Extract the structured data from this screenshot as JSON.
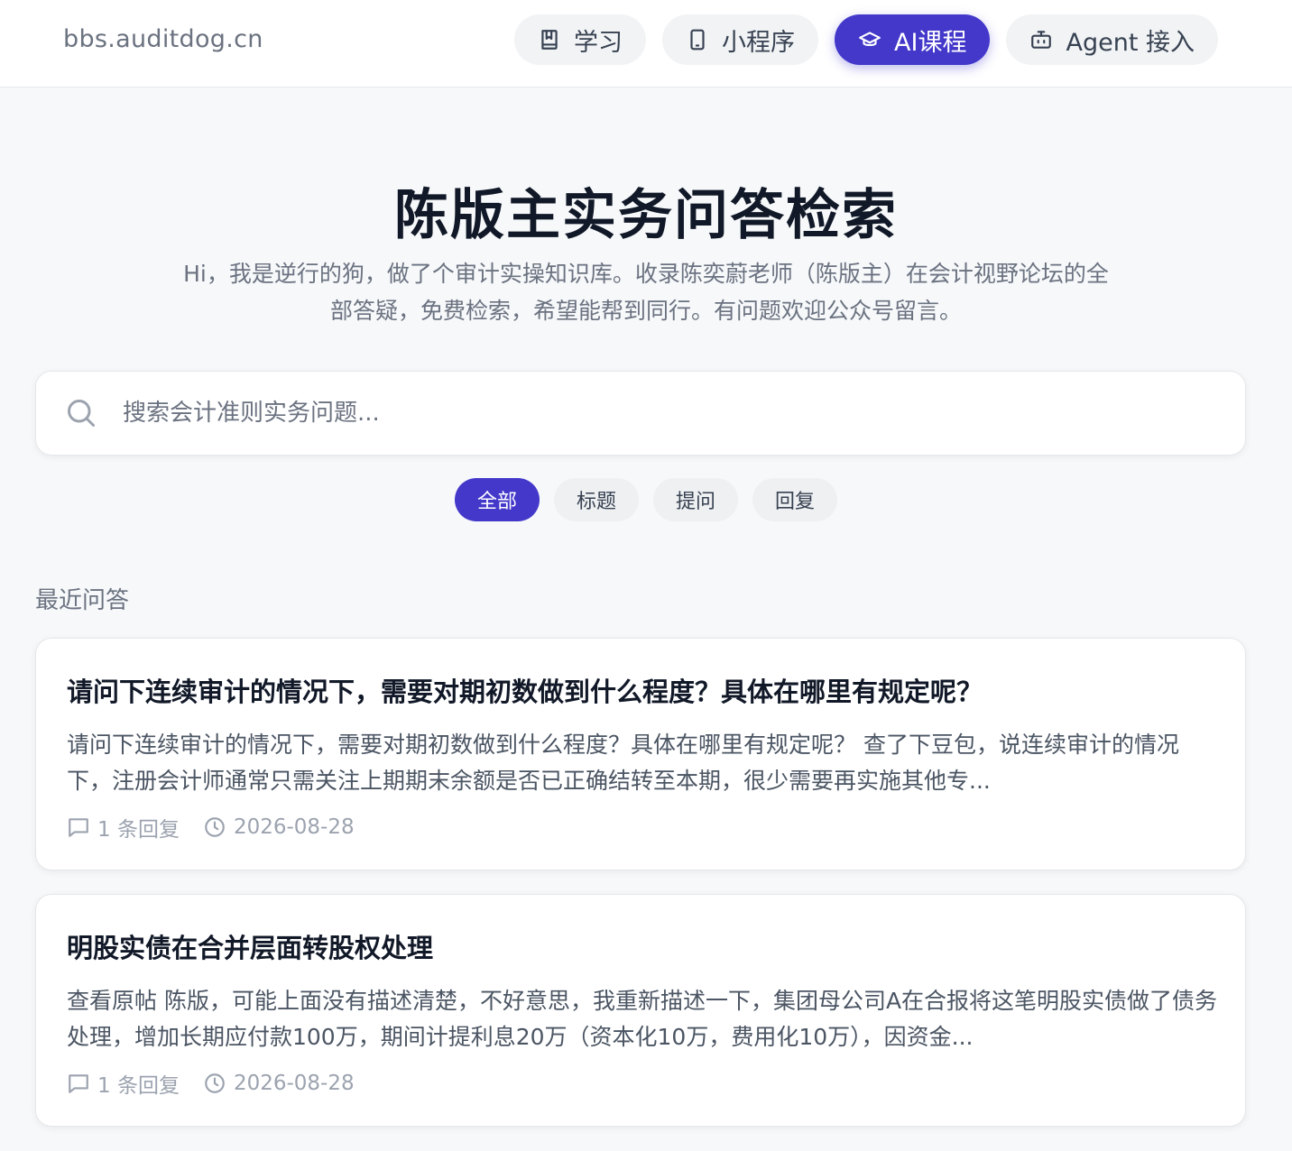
{
  "header": {
    "site_name": "bbs.auditdog.cn",
    "nav": [
      {
        "label": "学习",
        "icon": "book-icon",
        "active": false
      },
      {
        "label": "小程序",
        "icon": "phone-icon",
        "active": false
      },
      {
        "label": "AI课程",
        "icon": "graduation-cap-icon",
        "active": true
      },
      {
        "label": "Agent 接入",
        "icon": "robot-icon",
        "active": false
      }
    ]
  },
  "hero": {
    "title": "陈版主实务问答检索",
    "subtitle": "Hi，我是逆行的狗，做了个审计实操知识库。收录陈奕蔚老师（陈版主）在会计视野论坛的全部答疑，免费检索，希望能帮到同行。有问题欢迎公众号留言。"
  },
  "search": {
    "placeholder": "搜索会计准则实务问题...",
    "value": ""
  },
  "filters": [
    {
      "label": "全部",
      "active": true
    },
    {
      "label": "标题",
      "active": false
    },
    {
      "label": "提问",
      "active": false
    },
    {
      "label": "回复",
      "active": false
    }
  ],
  "section_label": "最近问答",
  "posts": [
    {
      "title": "请问下连续审计的情况下，需要对期初数做到什么程度？具体在哪里有规定呢？",
      "excerpt": "请问下连续审计的情况下，需要对期初数做到什么程度？具体在哪里有规定呢？ 查了下豆包，说连续审计的情况下，注册会计师通常只需关注上期期末余额是否已正确结转至本期，很少需要再实施其他专...",
      "replies": "1 条回复",
      "date": "2026-08-28"
    },
    {
      "title": "明股实债在合并层面转股权处理",
      "excerpt": "查看原帖 陈版，可能上面没有描述清楚，不好意思，我重新描述一下，集团母公司A在合报将这笔明股实债做了债务处理，增加长期应付款100万，期间计提利息20万（资本化10万，费用化10万），因资金...",
      "replies": "1 条回复",
      "date": "2026-08-28"
    }
  ],
  "colors": {
    "accent": "#4338ca",
    "background": "#f6f8fa",
    "text_muted": "#6b7280"
  }
}
